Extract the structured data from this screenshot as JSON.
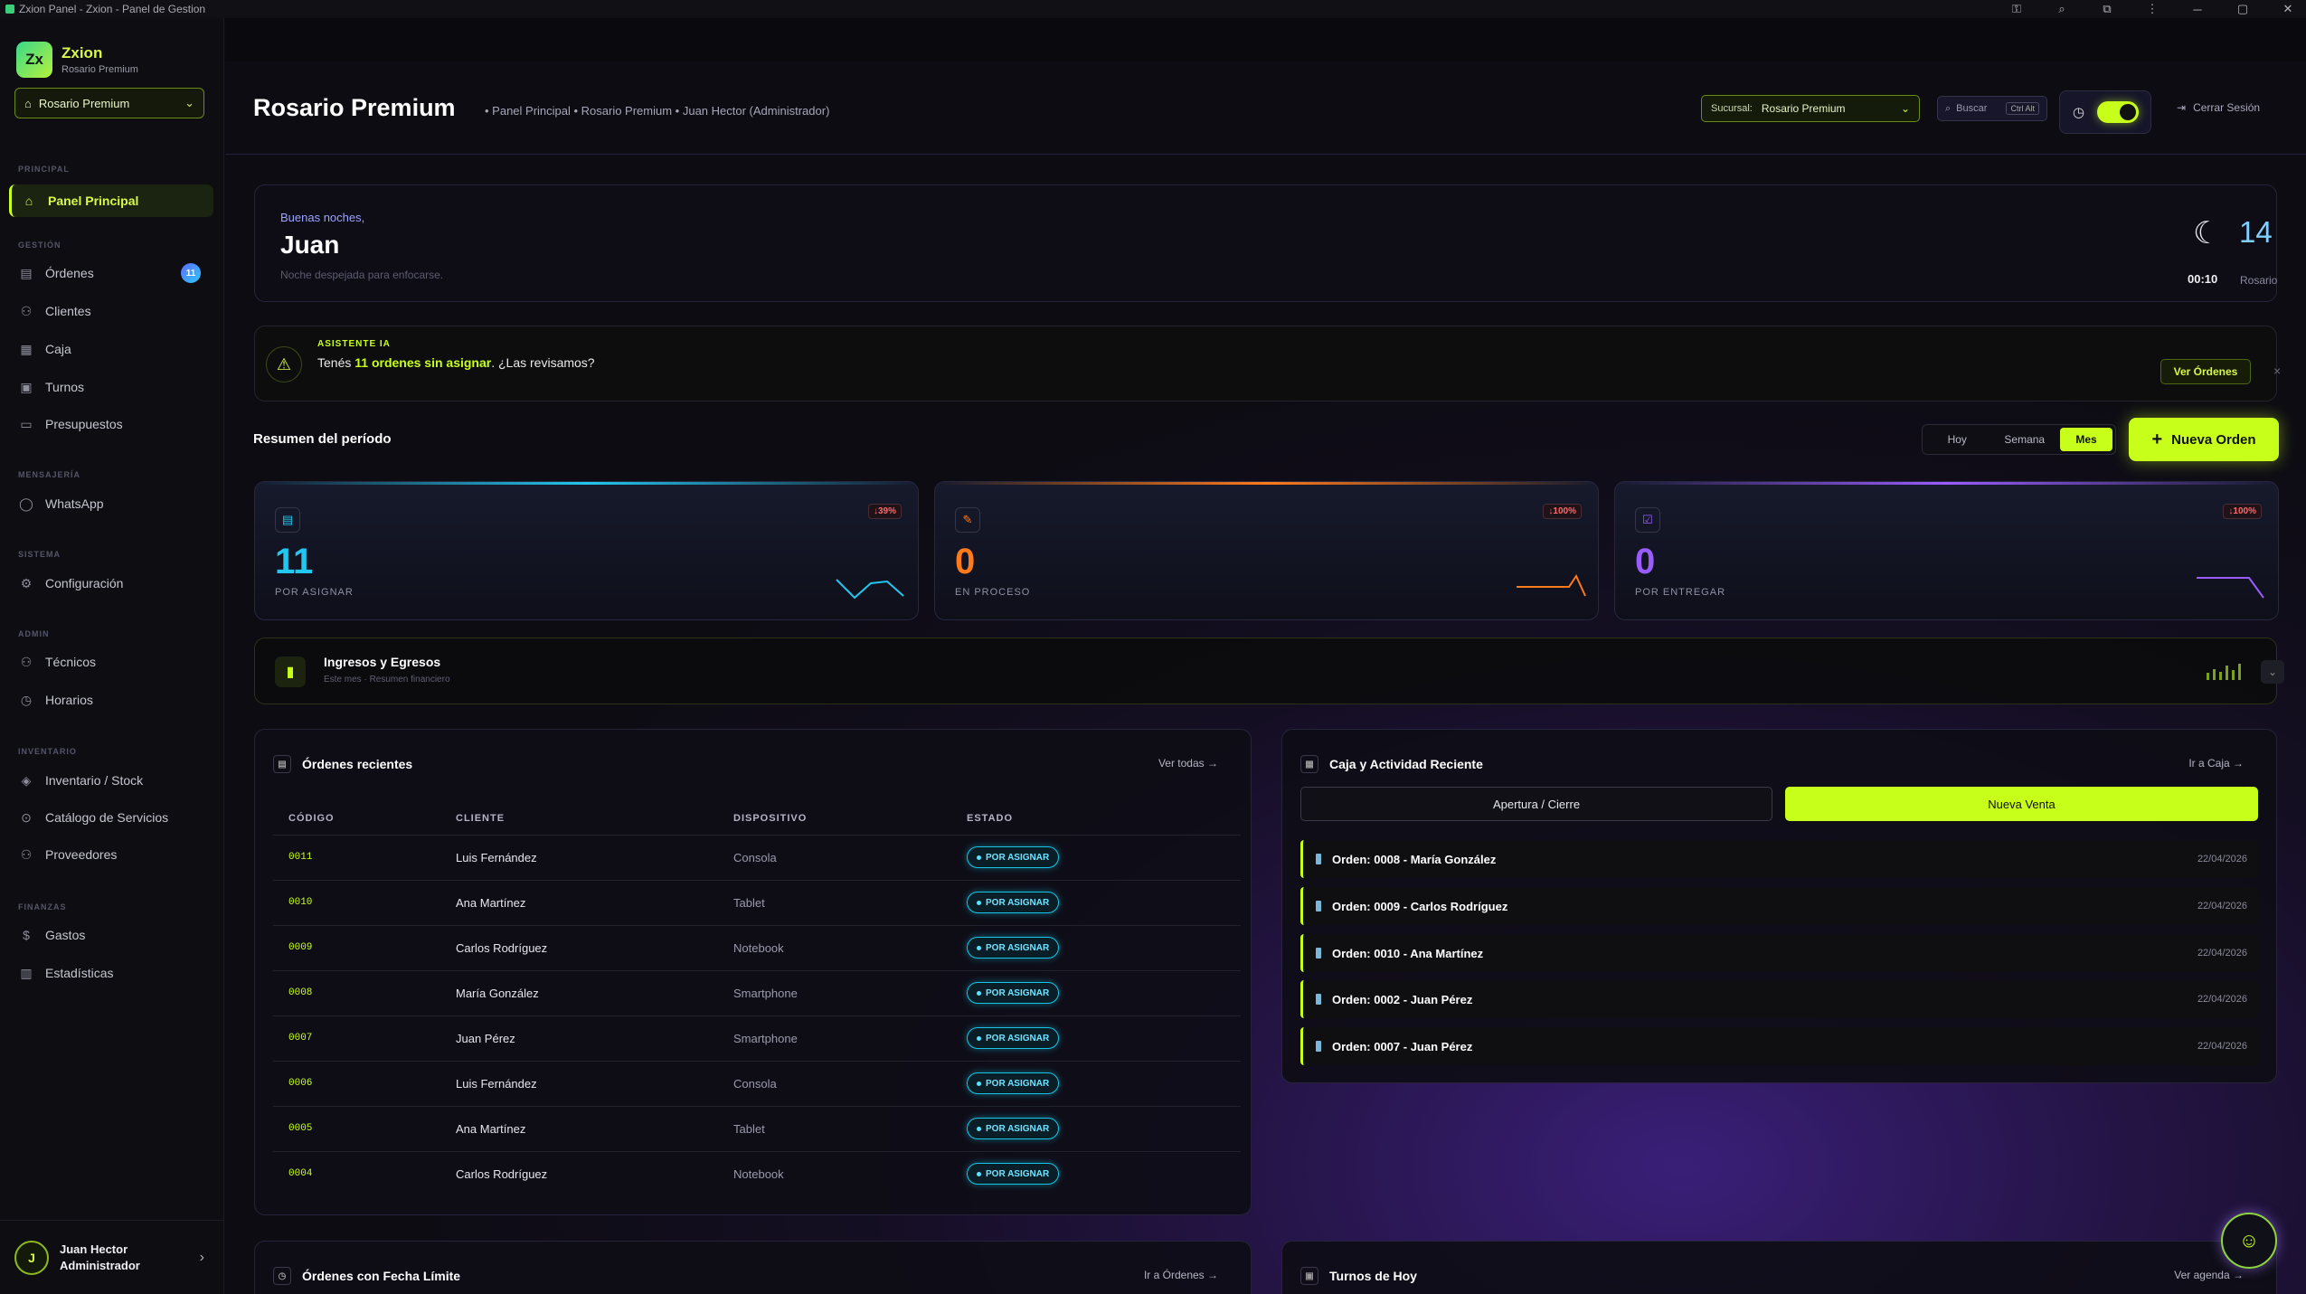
{
  "window": {
    "title": "Zxion Panel - Zxion - Panel de Gestion"
  },
  "brand": {
    "logo": "Zx",
    "name": "Zxion",
    "subtitle": "Rosario Premium",
    "branch": "Rosario Premium"
  },
  "sidebar": {
    "sections": {
      "principal": "PRINCIPAL",
      "gestion": "GESTIÓN",
      "mensajeria": "MENSAJERÍA",
      "sistema": "SISTEMA",
      "admin": "ADMIN",
      "inventario": "INVENTARIO",
      "finanzas": "FINANZAS"
    },
    "items": {
      "panel": "Panel Principal",
      "ordenes": "Órdenes",
      "ordenes_badge": "11",
      "clientes": "Clientes",
      "caja": "Caja",
      "turnos": "Turnos",
      "presupuestos": "Presupuestos",
      "whatsapp": "WhatsApp",
      "configuracion": "Configuración",
      "tecnicos": "Técnicos",
      "horarios": "Horarios",
      "inventario": "Inventario / Stock",
      "catalogo": "Catálogo de Servicios",
      "proveedores": "Proveedores",
      "gastos": "Gastos",
      "estadisticas": "Estadísticas"
    }
  },
  "user": {
    "initial": "J",
    "name": "Juan Hector",
    "role": "Administrador"
  },
  "header": {
    "title": "Rosario Premium",
    "breadcrumb": "• Panel Principal • Rosario Premium • Juan Hector (Administrador)",
    "branch_label": "Sucursal:",
    "branch_value": "Rosario Premium",
    "search_placeholder": "Buscar",
    "search_kbd": "Ctrl Alt",
    "logout": "Cerrar Sesión"
  },
  "greeting": {
    "hello": "Buenas noches,",
    "name": "Juan",
    "sub": "Noche despejada para enfocarse.",
    "time": "00:10",
    "temp": "14",
    "city": "Rosario"
  },
  "ai": {
    "tag": "ASISTENTE IA",
    "msg_pre": "Tenés ",
    "msg_bold": "11 ordenes sin asignar",
    "msg_post": ". ¿Las revisamos?",
    "button": "Ver Órdenes",
    "close": "×"
  },
  "summary": {
    "title": "Resumen del período",
    "periods": [
      "Hoy",
      "Semana",
      "Mes"
    ],
    "new_order": "Nueva Orden"
  },
  "stats": [
    {
      "value": "11",
      "label": "POR ASIGNAR",
      "delta": "↓39%",
      "color": "#22c6ee"
    },
    {
      "value": "0",
      "label": "EN PROCESO",
      "delta": "↓100%",
      "color": "#ff7a1a"
    },
    {
      "value": "0",
      "label": "POR ENTREGAR",
      "delta": "↓100%",
      "color": "#9a5cff"
    }
  ],
  "income": {
    "title": "Ingresos y Egresos",
    "sub": "Este mes · Resumen financiero"
  },
  "orders": {
    "title": "Órdenes recientes",
    "link": "Ver todas →",
    "columns": [
      "CÓDIGO",
      "CLIENTE",
      "DISPOSITIVO",
      "ESTADO"
    ],
    "rows": [
      {
        "code": "0011",
        "client": "Luis Fernández",
        "device": "Consola",
        "status": "POR ASIGNAR"
      },
      {
        "code": "0010",
        "client": "Ana Martínez",
        "device": "Tablet",
        "status": "POR ASIGNAR"
      },
      {
        "code": "0009",
        "client": "Carlos Rodríguez",
        "device": "Notebook",
        "status": "POR ASIGNAR"
      },
      {
        "code": "0008",
        "client": "María González",
        "device": "Smartphone",
        "status": "POR ASIGNAR"
      },
      {
        "code": "0007",
        "client": "Juan Pérez",
        "device": "Smartphone",
        "status": "POR ASIGNAR"
      },
      {
        "code": "0006",
        "client": "Luis Fernández",
        "device": "Consola",
        "status": "POR ASIGNAR"
      },
      {
        "code": "0005",
        "client": "Ana Martínez",
        "device": "Tablet",
        "status": "POR ASIGNAR"
      },
      {
        "code": "0004",
        "client": "Carlos Rodríguez",
        "device": "Notebook",
        "status": "POR ASIGNAR"
      }
    ]
  },
  "caja": {
    "title": "Caja y Actividad Reciente",
    "link": "Ir a Caja →",
    "btn_open": "Apertura / Cierre",
    "btn_sale": "Nueva Venta",
    "activity": [
      {
        "text": "Orden: 0008 - María González",
        "date": "22/04/2026"
      },
      {
        "text": "Orden: 0009 - Carlos Rodríguez",
        "date": "22/04/2026"
      },
      {
        "text": "Orden: 0010 - Ana Martínez",
        "date": "22/04/2026"
      },
      {
        "text": "Orden: 0002 - Juan Pérez",
        "date": "22/04/2026"
      },
      {
        "text": "Orden: 0007 - Juan Pérez",
        "date": "22/04/2026"
      }
    ]
  },
  "deadline": {
    "title": "Órdenes con Fecha Límite",
    "link": "Ir a Órdenes →"
  },
  "turnos": {
    "title": "Turnos de Hoy",
    "link": "Ver agenda →"
  }
}
